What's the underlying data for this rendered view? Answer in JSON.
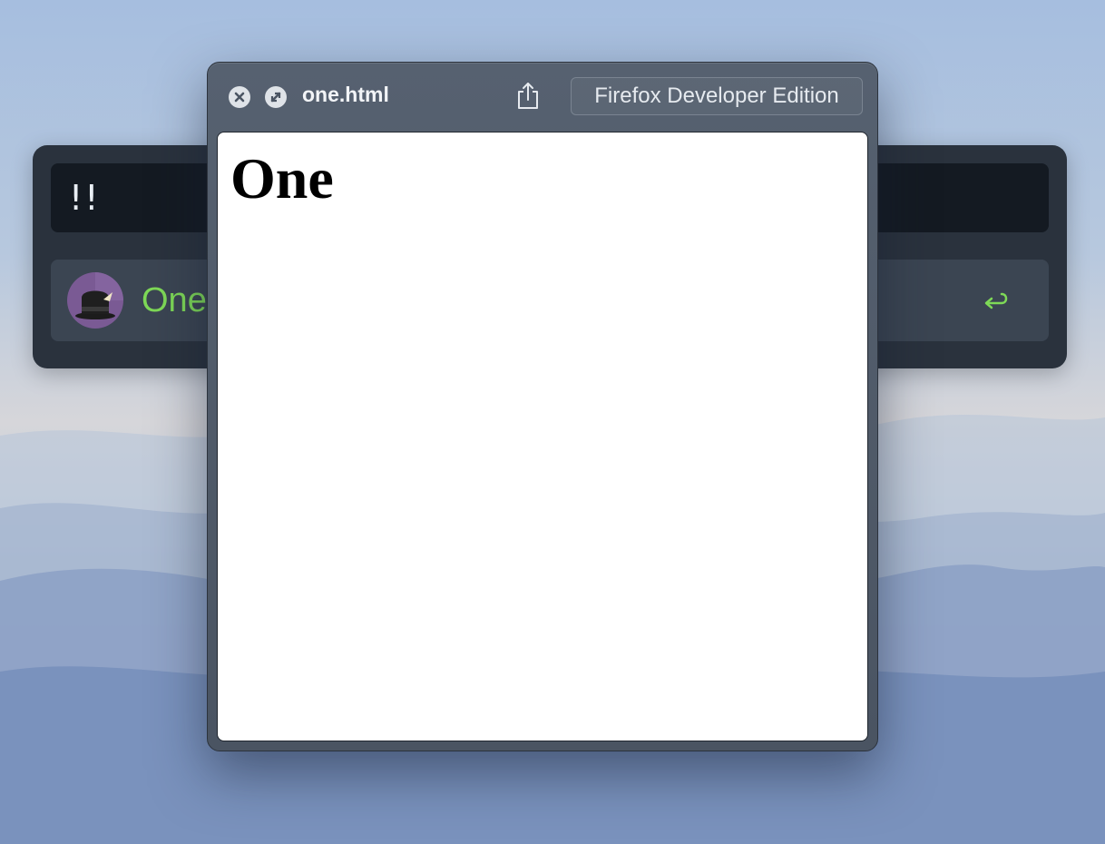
{
  "launcher": {
    "query": "!!",
    "result": {
      "title": "One",
      "icon": "alfred-hat-icon",
      "action_icon": "return-icon"
    },
    "colors": {
      "result_text": "#7ed957",
      "background": "#2a323d"
    }
  },
  "quicklook": {
    "filename": "one.html",
    "open_with_label": "Firefox Developer Edition",
    "buttons": {
      "close_icon": "close-icon",
      "fullscreen_icon": "fullscreen-icon",
      "share_icon": "share-icon"
    },
    "page": {
      "heading": "One"
    }
  }
}
